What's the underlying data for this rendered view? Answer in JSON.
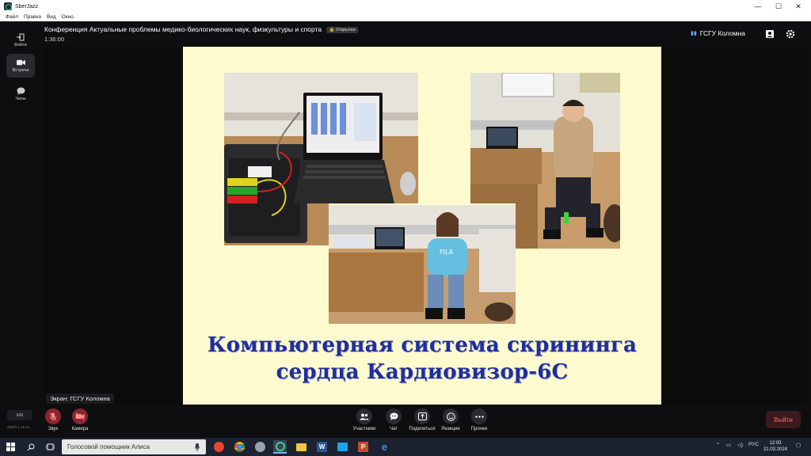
{
  "window": {
    "app_title": "SberJazz",
    "controls": {
      "minimize": "—",
      "maximize": "☐",
      "close": "✕"
    }
  },
  "menu": [
    "Файл",
    "Правка",
    "Вид",
    "Окно"
  ],
  "sidebar": {
    "items": [
      {
        "label": "Войти",
        "icon": "login-icon",
        "active": false
      },
      {
        "label": "Встречи",
        "icon": "camera-icon",
        "active": true
      },
      {
        "label": "Чаты",
        "icon": "chat-icon",
        "active": false
      }
    ]
  },
  "header": {
    "title": "Конференция Актуальные проблемы медико-биологических наук, физкультуры и спорта",
    "badge": "Открытая",
    "timer": "1:36:00",
    "room_name": "ГСГУ Коломна"
  },
  "slide": {
    "caption_line1": "Компьютерная система скрининга",
    "caption_line2": "сердца Кардиовизор-6С",
    "background": "#fdfbce",
    "caption_color": "#1f2e9e"
  },
  "screen_label": "Экран: ГСГУ Коломна",
  "controls_left": {
    "lang": "EN",
    "version": "SBER 1.42.31",
    "sound": "Звук",
    "camera": "Камера"
  },
  "controls_center": [
    "Участники",
    "Чат",
    "Поделиться",
    "Реакции",
    "Прочее"
  ],
  "leave_label": "Выйти",
  "taskbar": {
    "search_text": "Голосовой помощник Алиса",
    "lang": "РУС",
    "time": "12:03",
    "date": "21.03.2024"
  },
  "colors": {
    "accent_green": "#3fd08c",
    "danger": "#8c2430",
    "leave_text": "#ff6a6a"
  }
}
